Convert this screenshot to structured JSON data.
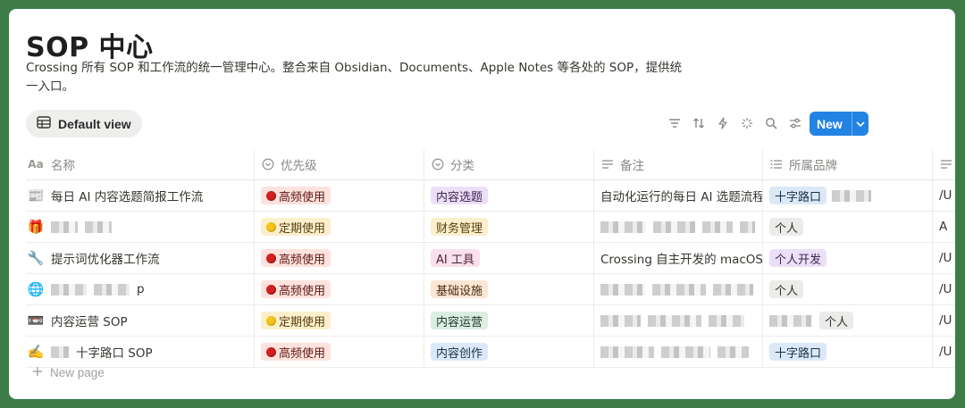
{
  "page": {
    "title": "SOP 中心",
    "description": "Crossing 所有 SOP 和工作流的统一管理中心。整合来自 Obsidian、Documents、Apple Notes 等各处的 SOP，提供统一入口。"
  },
  "view": {
    "label": "Default view",
    "icon": "table-icon"
  },
  "toolbar": {
    "icons": [
      "filter-icon",
      "sort-icon",
      "automation-icon",
      "ai-sparkle-icon",
      "search-icon",
      "settings-sliders-icon"
    ],
    "new_label": "New"
  },
  "columns": [
    {
      "label": "名称",
      "icon": "text-aa-icon"
    },
    {
      "label": "优先级",
      "icon": "select-icon"
    },
    {
      "label": "分类",
      "icon": "select-icon"
    },
    {
      "label": "备注",
      "icon": "text-lines-icon"
    },
    {
      "label": "所属品牌",
      "icon": "multiselect-list-icon"
    },
    {
      "label": "",
      "icon": "text-lines-icon"
    }
  ],
  "rows": [
    {
      "emoji": "📰",
      "name": "每日 AI 内容选题简报工作流",
      "priority": "高频使用",
      "priority_color": "red",
      "category": "内容选题",
      "category_color": "purple",
      "note": "自动化运行的每日 AI 选题流程，",
      "brands": [
        "十字路口"
      ],
      "extra": "/U"
    },
    {
      "emoji": "🎁",
      "name": "",
      "priority": "定期使用",
      "priority_color": "yellow",
      "category": "财务管理",
      "category_color": "yellow",
      "note": "",
      "brands": [
        "个人"
      ],
      "extra": "A"
    },
    {
      "emoji": "🔧",
      "name": "提示词优化器工作流",
      "priority": "高频使用",
      "priority_color": "red",
      "category": "AI 工具",
      "category_color": "pink",
      "note": "Crossing 自主开发的 macOS 提",
      "brands": [
        "个人开发"
      ],
      "extra": "/U"
    },
    {
      "emoji": "🌐",
      "name": "p",
      "priority": "高频使用",
      "priority_color": "red",
      "category": "基础设施",
      "category_color": "orange",
      "note": "",
      "brands": [
        "个人"
      ],
      "extra": "/U"
    },
    {
      "emoji": "📼",
      "name": "内容运营 SOP",
      "priority": "定期使用",
      "priority_color": "yellow",
      "category": "内容运营",
      "category_color": "green",
      "note": "",
      "brands": [
        "个人"
      ],
      "extra": "/U"
    },
    {
      "emoji": "✍️",
      "name": "十字路口 SOP",
      "priority": "高频使用",
      "priority_color": "red",
      "category": "内容创作",
      "category_color": "blue",
      "note": "",
      "brands": [
        "十字路口"
      ],
      "extra": "/U"
    }
  ],
  "footer": {
    "new_page_label": "New page"
  },
  "colors": {
    "frame_border": "#3d7c47",
    "accent": "#2383e2",
    "tag_red_bg": "#fde2dd",
    "tag_red_fg": "#5d1715",
    "tag_yellow_bg": "#fbefcc",
    "tag_yellow_fg": "#5a3e0b",
    "tag_purple_bg": "#ece0f8",
    "tag_purple_fg": "#412454",
    "tag_pink_bg": "#f9e0ec",
    "tag_pink_fg": "#4c2337",
    "tag_orange_bg": "#fbe6d4",
    "tag_orange_fg": "#49290e",
    "tag_green_bg": "#dcede2",
    "tag_green_fg": "#1c3829",
    "tag_blue_bg": "#dbe8f7",
    "tag_blue_fg": "#183347",
    "tag_gray_bg": "#ebebea",
    "tag_gray_fg": "#32302c"
  }
}
